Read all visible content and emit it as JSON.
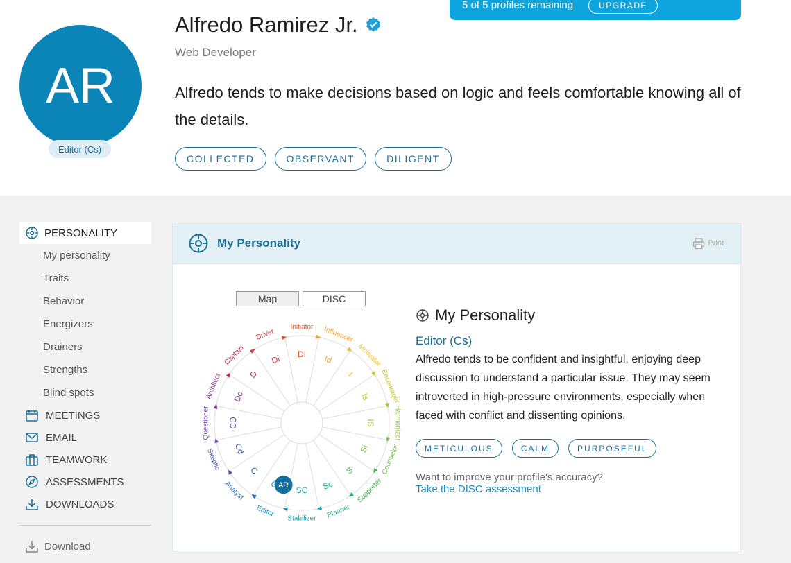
{
  "profile": {
    "initials": "AR",
    "name": "Alfredo Ramirez Jr.",
    "role": "Web Developer",
    "type_badge": "Editor (Cs)",
    "summary": "Alfredo tends to make decisions based on logic and feels comfortable knowing all of the details.",
    "tags": [
      "COLLECTED",
      "OBSERVANT",
      "DILIGENT"
    ]
  },
  "banner": {
    "text": "5 of 5 profiles remaining",
    "upgrade_label": "UPGRADE"
  },
  "sidebar": {
    "active_label": "PERSONALITY",
    "sub_items": [
      "My personality",
      "Traits",
      "Behavior",
      "Energizers",
      "Drainers",
      "Strengths",
      "Blind spots"
    ],
    "main_items": [
      {
        "label": "MEETINGS",
        "icon": "calendar-icon"
      },
      {
        "label": "EMAIL",
        "icon": "envelope-icon"
      },
      {
        "label": "TEAMWORK",
        "icon": "briefcase-icon"
      },
      {
        "label": "ASSESSMENTS",
        "icon": "compass-icon"
      },
      {
        "label": "DOWNLOADS",
        "icon": "download-icon"
      }
    ],
    "download_label": "Download"
  },
  "panel": {
    "title": "My Personality",
    "print_label": "Print",
    "toggle_map": "Map",
    "toggle_disc": "DISC"
  },
  "wheel": {
    "outer_labels": [
      "Initiator",
      "Influencer",
      "Motivator",
      "Encourager",
      "Harmonizer",
      "Counselor",
      "Supporter",
      "Planner",
      "Stabilizer",
      "Editor",
      "Analyst",
      "Skeptic",
      "Questioner",
      "Architect",
      "Captain",
      "Driver"
    ],
    "inner_labels": [
      "DI",
      "Id",
      "I",
      "Is",
      "IS",
      "Si",
      "S",
      "Sc",
      "SC",
      "Cs",
      "C",
      "Cd",
      "CD",
      "Dc",
      "D",
      "Di"
    ],
    "marker_initials": "AR"
  },
  "info": {
    "title": "My Personality",
    "type": "Editor (Cs)",
    "description": "Alfredo tends to be confident and insightful, enjoying deep discussion to understand a particular issue. They may seem introverted in high-pressure environments, especially when faced with conflict and dissenting opinions.",
    "tags": [
      "METICULOUS",
      "CALM",
      "PURPOSEFUL"
    ],
    "improve_text": "Want to improve your profile's accuracy?",
    "improve_link": "Take the DISC assessment"
  }
}
